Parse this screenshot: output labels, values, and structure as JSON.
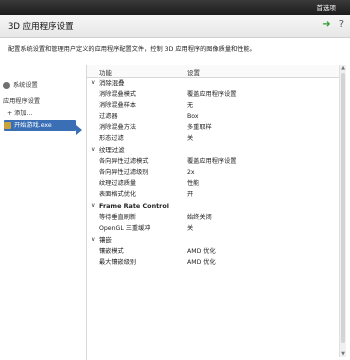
{
  "topbar": {
    "preset_label": "首选项"
  },
  "header": {
    "title": "3D 应用程序设置",
    "icons": [
      "back-arrow-icon",
      "help-icon"
    ]
  },
  "description": "配置系统设置和管理用户定义的应用程序配置文件，控制 3D 应用程序的图像质量和性能。",
  "sidebar": {
    "items": [
      {
        "label": "系统设置",
        "icon": "system-settings-icon"
      },
      {
        "label": "应用程序设置"
      },
      {
        "label": "+ 添加..."
      },
      {
        "label": "开始游戏.exe",
        "icon": "app-icon",
        "selected": true
      }
    ]
  },
  "table": {
    "col_feature": "功能",
    "col_setting": "设置",
    "sections": [
      {
        "title": "消除混叠",
        "bold": false,
        "rows": [
          {
            "k": "消除混叠模式",
            "v": "覆盖应用程序设置"
          },
          {
            "k": "消除混叠样本",
            "v": "无"
          },
          {
            "k": "过滤器",
            "v": "Box"
          },
          {
            "k": "消除混叠方法",
            "v": "多重取样"
          },
          {
            "k": "形态过滤",
            "v": "关"
          }
        ]
      },
      {
        "title": "纹理过滤",
        "bold": false,
        "rows": [
          {
            "k": "各向异性过滤模式",
            "v": "覆盖应用程序设置"
          },
          {
            "k": "各向异性过滤级别",
            "v": "2x"
          },
          {
            "k": "纹理过滤质量",
            "v": "性能"
          },
          {
            "k": "表面格式优化",
            "v": "开"
          }
        ]
      },
      {
        "title": "Frame Rate Control",
        "bold": true,
        "rows": [
          {
            "k": "等待垂直刷新",
            "v": "始终关闭"
          },
          {
            "k": "OpenGL 三重缓冲",
            "v": "关"
          }
        ]
      },
      {
        "title": "镶嵌",
        "bold": false,
        "rows": [
          {
            "k": "镶嵌模式",
            "v": "AMD 优化"
          },
          {
            "k": "最大镶嵌级别",
            "v": "AMD 优化"
          }
        ]
      }
    ]
  },
  "colors": {
    "accent": "#3a6fb6",
    "back_arrow": "#2f9e33"
  }
}
